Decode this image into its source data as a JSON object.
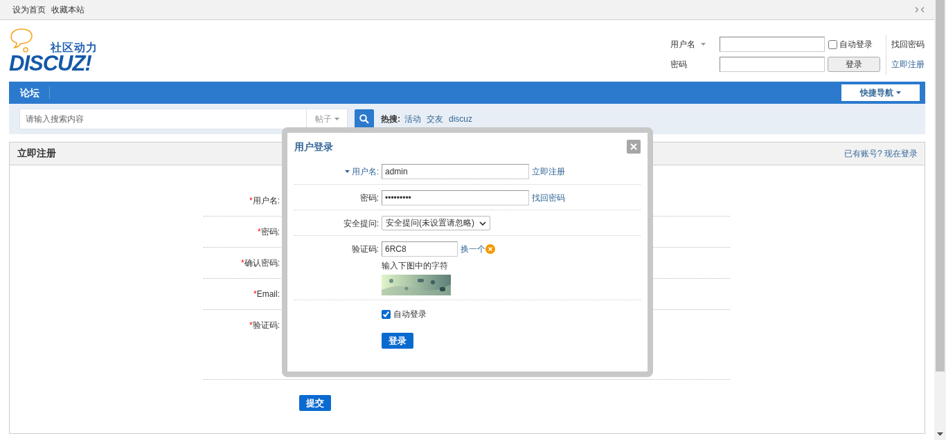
{
  "topbar": {
    "links": [
      "设为首页",
      "收藏本站"
    ]
  },
  "logo": {
    "tagline": "社区动力",
    "wordmark": "DISCUZ!"
  },
  "quick_login": {
    "username_label": "用户名",
    "password_label": "密码",
    "remember": {
      "label": "自动登录",
      "checked": false
    },
    "login_button": "登录",
    "links": [
      "找回密码",
      "立即注册"
    ]
  },
  "nav": {
    "items": [
      "论坛"
    ],
    "quick_nav": "快捷导航"
  },
  "search": {
    "placeholder": "请输入搜索内容",
    "scope": "帖子",
    "hot_label": "热搜:",
    "hot": [
      "活动",
      "交友",
      "discuz"
    ]
  },
  "register": {
    "title": "立即注册",
    "login_link": "已有账号? 现在登录",
    "fields": [
      {
        "mark": "*",
        "label": "用户名:",
        "kind": "short"
      },
      {
        "mark": "*",
        "label": "密码:",
        "kind": "short"
      },
      {
        "mark": "*",
        "label": "确认密码:",
        "kind": "short"
      },
      {
        "mark": "*",
        "label": "Email:",
        "kind": "short"
      },
      {
        "mark": "*",
        "label": "验证码:",
        "kind": "tall"
      }
    ],
    "submit": "提交"
  },
  "login_dialog": {
    "title": "用户登录",
    "rows": [
      {
        "kind": "text",
        "label": "用户名:",
        "value": "admin",
        "link": "立即注册",
        "dropdown": true
      },
      {
        "kind": "text",
        "label": "密码:",
        "value": "•••••••••",
        "link": "找回密码",
        "dropdown": false
      },
      {
        "kind": "select",
        "label": "安全提问:",
        "value": "安全提问(未设置请忽略)"
      },
      {
        "kind": "captcha",
        "label": "验证码:",
        "value": "6RC8",
        "link": "换一个",
        "error": true,
        "hint": "输入下图中的字符"
      }
    ],
    "remember": {
      "label": "自动登录",
      "checked": true
    },
    "submit": "登录"
  }
}
